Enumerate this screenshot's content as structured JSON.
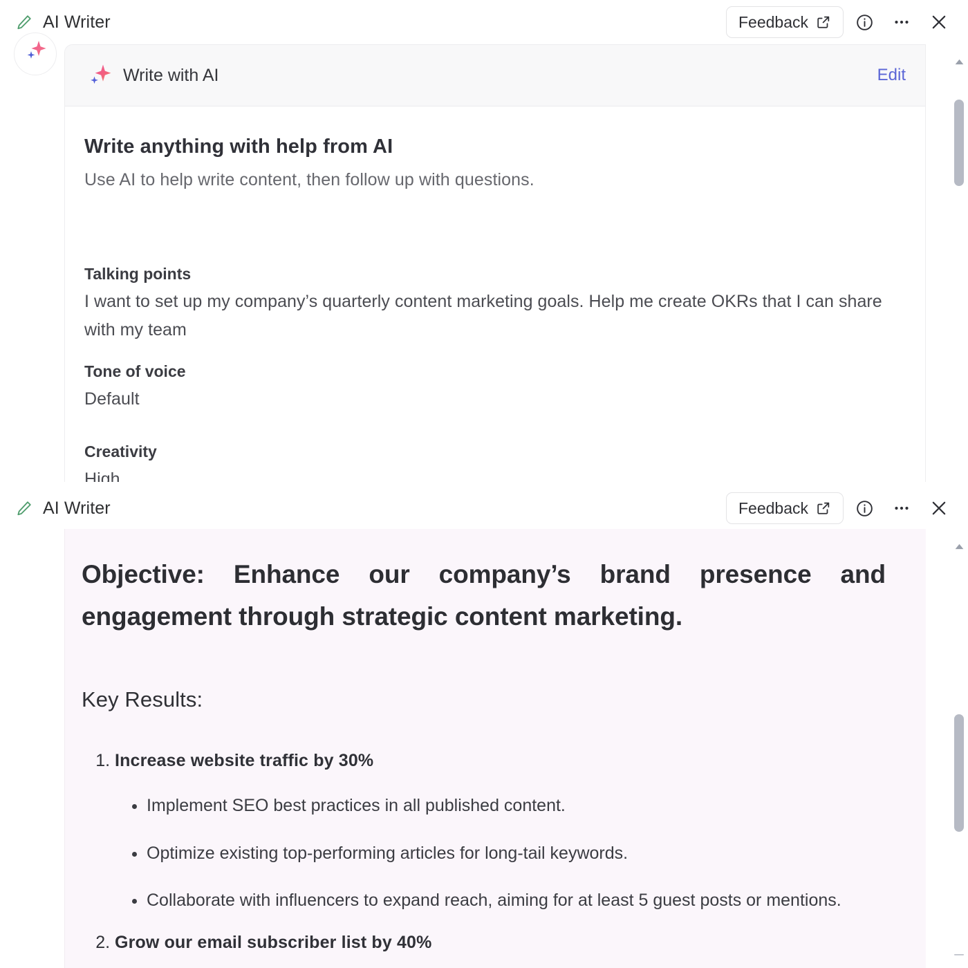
{
  "window": {
    "title": "AI Writer",
    "pencil_icon": "pencil-icon",
    "accent_green": "#4f9d6d",
    "actions": {
      "feedback_label": "Feedback",
      "feedback_icon": "external-link-icon",
      "info_icon": "info-circle-icon",
      "more_icon": "ellipsis-icon",
      "close_icon": "close-icon"
    }
  },
  "top_panel": {
    "avatar_icon": "ai-sparkle-icon",
    "card": {
      "header_icon": "ai-sparkle-icon",
      "header_label": "Write with AI",
      "edit_label": "Edit",
      "promo_title": "Write anything with help from AI",
      "promo_subtitle": "Use AI to help write content, then follow up with questions.",
      "fields": [
        {
          "label": "Talking points",
          "value": "I want to set up my company’s quarterly content marketing goals. Help me create OKRs that I can share with my team"
        },
        {
          "label": "Tone of voice",
          "value": "Default"
        },
        {
          "label": "Creativity",
          "value": "High"
        }
      ]
    },
    "scrollbar": {
      "up_arrow_icon": "caret-up-icon",
      "thumb_top_pct": 12,
      "thumb_height_pct": 20
    }
  },
  "bottom_panel": {
    "background_color": "#fbf6fb",
    "objective": "Objective: Enhance our company’s brand presence and engagement through strategic content marketing.",
    "key_results_heading": "Key Results:",
    "key_results": [
      {
        "number": "1.",
        "title": "Increase website traffic by 30%",
        "bullets": [
          "Implement SEO best practices in all published content.",
          "Optimize existing top-performing articles for long-tail keywords.",
          "Collaborate with influencers to expand reach, aiming for at least 5 guest posts or mentions."
        ]
      },
      {
        "number": "2.",
        "title": "Grow our email subscriber list by 40%",
        "bullets": []
      }
    ],
    "scrollbar": {
      "up_arrow_icon": "caret-up-icon",
      "down_arrow_icon": "scroll-end-icon",
      "thumb_top_pct": 42,
      "thumb_height_pct": 26
    }
  }
}
